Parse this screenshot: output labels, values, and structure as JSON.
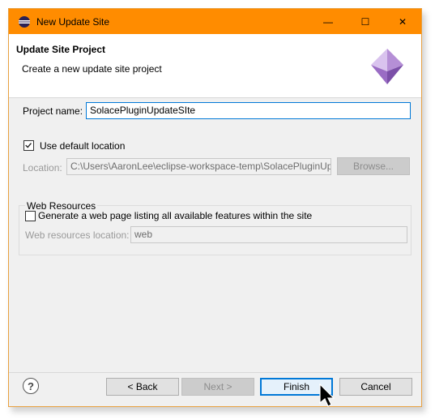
{
  "window": {
    "title": "New Update Site",
    "controls": {
      "minimize": "—",
      "maximize": "☐",
      "close": "✕"
    }
  },
  "header": {
    "title": "Update Site Project",
    "description": "Create a new update site project"
  },
  "form": {
    "project_name_label": "Project name:",
    "project_name_value": "SolacePluginUpdateSIte",
    "use_default_label": "Use default location",
    "use_default_checked": true,
    "location_label": "Location:",
    "location_value": "C:\\Users\\AaronLee\\eclipse-workspace-temp\\SolacePluginUpdateSIte",
    "browse_label": "Browse..."
  },
  "web_resources": {
    "group_label": "Web Resources",
    "generate_label": "Generate a web page listing all available features within the site",
    "generate_checked": false,
    "location_label": "Web resources location:",
    "location_value": "web"
  },
  "buttons": {
    "help": "?",
    "back": "< Back",
    "next": "Next >",
    "finish": "Finish",
    "cancel": "Cancel"
  },
  "colors": {
    "titlebar": "#ff8c00",
    "focus": "#0078d7"
  }
}
